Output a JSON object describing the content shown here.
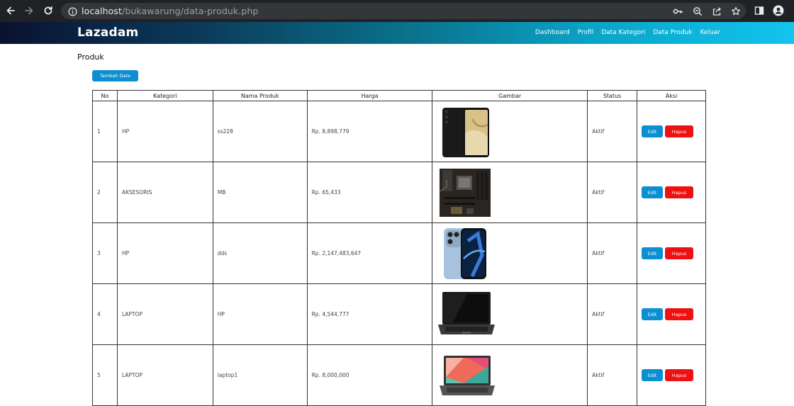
{
  "browser": {
    "url_host": "localhost",
    "url_path": "/bukawarung/data-produk.php"
  },
  "header": {
    "brand": "Lazadam",
    "menu": [
      "Dashboard",
      "Profil",
      "Data Kategori",
      "Data Produk",
      "Keluar"
    ]
  },
  "page": {
    "title": "Produk",
    "add_button": "Tambah Data"
  },
  "table": {
    "headers": [
      "No",
      "Kategori",
      "Nama Produk",
      "Harga",
      "Gambar",
      "Status",
      "Aksi"
    ],
    "edit_label": "Edit",
    "delete_label": "Hapus",
    "rows": [
      {
        "no": "1",
        "kategori": "HP",
        "nama": "ss228",
        "harga": "Rp. 8,898,779",
        "status": "Aktif",
        "image": "smartphone-galaxy-image"
      },
      {
        "no": "2",
        "kategori": "AKSESORIS",
        "nama": "MB",
        "harga": "Rp. 65,433",
        "status": "Aktif",
        "image": "motherboard-image"
      },
      {
        "no": "3",
        "kategori": "HP",
        "nama": "dds",
        "harga": "Rp. 2,147,483,647",
        "status": "Aktif",
        "image": "iphone-blue-image"
      },
      {
        "no": "4",
        "kategori": "LAPTOP",
        "nama": "HP",
        "harga": "Rp. 4,544,777",
        "status": "Aktif",
        "image": "laptop-black-image"
      },
      {
        "no": "5",
        "kategori": "LAPTOP",
        "nama": "laptop1",
        "harga": "Rp. 8,000,000",
        "status": "Aktif",
        "image": "laptop-colorful-image"
      }
    ]
  },
  "colors": {
    "primary_button": "#0b8fd1",
    "danger_button": "#ee1111",
    "browser_bg": "#202124"
  }
}
